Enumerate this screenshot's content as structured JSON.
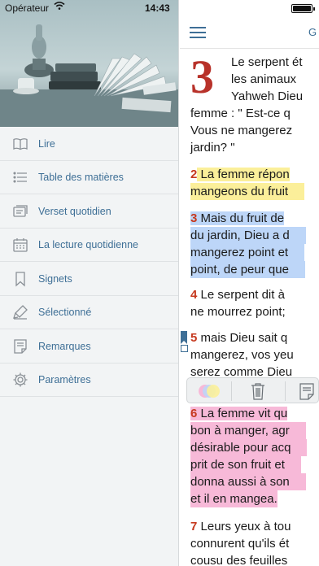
{
  "status_bar": {
    "carrier": "Opérateur",
    "time": "14:43",
    "battery_level": 1.0
  },
  "sidebar": {
    "items": [
      {
        "label": "Lire",
        "icon": "open-book-icon"
      },
      {
        "label": "Table des matières",
        "icon": "list-icon"
      },
      {
        "label": "Verset quotidien",
        "icon": "cards-icon"
      },
      {
        "label": "La lecture quotidienne",
        "icon": "calendar-icon"
      },
      {
        "label": "Signets",
        "icon": "bookmark-icon"
      },
      {
        "label": "Sélectionné",
        "icon": "highlighter-icon"
      },
      {
        "label": "Remarques",
        "icon": "note-icon"
      },
      {
        "label": "Paramètres",
        "icon": "gear-icon"
      }
    ]
  },
  "reader": {
    "header_title": "G",
    "chapter_number": "3",
    "lines": {
      "l1": "Le serpent ét",
      "l2": "les animaux",
      "l3": "Yahweh Dieu",
      "l4": "femme : \" Est-ce q",
      "l5": "Vous ne mangerez",
      "l6": "jardin? \"",
      "v2_num": "2",
      "v2_a": " La femme répon",
      "v2_b": "mangeons du fruit",
      "v3_num": "3",
      "v3_a": " Mais du fruit de",
      "v3_b": "du jardin, Dieu a d",
      "v3_c": "mangerez point et",
      "v3_d": "point, de peur que",
      "v4_num": "4",
      "v4_a": " Le serpent dit à",
      "v4_b": "ne mourrez point;",
      "v5_num": "5",
      "v5_a": " mais Dieu sait q",
      "v5_b": "mangerez, vos yeu",
      "v5_c": "serez comme Dieu",
      "v6_num": "6",
      "v6_a": " La femme vit qu",
      "v6_b": "bon à manger, agr",
      "v6_c": "désirable pour acq",
      "v6_d": "prit de son fruit et",
      "v6_e": "donna aussi à son",
      "v6_f": "et il en mangea.",
      "v7_num": "7",
      "v7_a": " Leurs yeux à tou",
      "v7_b": "connurent qu'ils ét",
      "v7_c": "cousu des feuilles"
    },
    "highlight_colors": {
      "yellow": "#fbef9a",
      "blue": "#bdd6f8",
      "pink": "#f7b9d8"
    },
    "toolbar_icons": [
      "color-palette-icon",
      "trash-icon",
      "note-icon"
    ]
  },
  "colors": {
    "accent": "#3e6f96",
    "verse_number": "#c6391f",
    "drop_cap": "#b8322a"
  }
}
